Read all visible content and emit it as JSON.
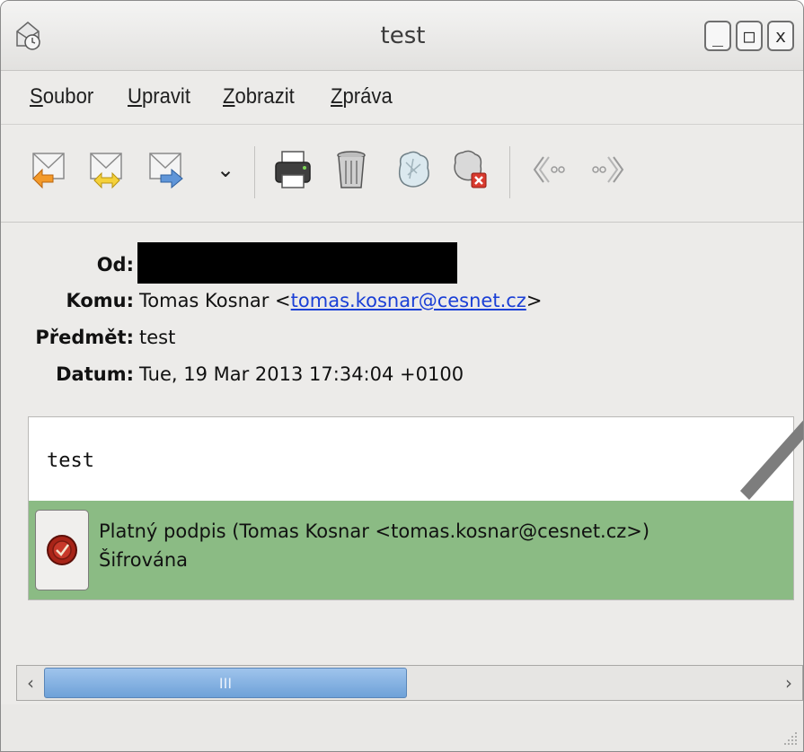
{
  "window": {
    "title": "test",
    "controls": {
      "minimize": "_",
      "maximize": "□",
      "close": "x"
    }
  },
  "menu": {
    "items": [
      {
        "mnemonic": "S",
        "rest": "oubor"
      },
      {
        "mnemonic": "U",
        "rest": "pravit"
      },
      {
        "mnemonic": "Z",
        "rest": "obrazit"
      },
      {
        "mnemonic": "Z",
        "rest": "práva"
      }
    ]
  },
  "toolbar": {
    "icons": [
      "reply-icon",
      "reply-all-icon",
      "forward-icon",
      "dropdown-arrow-icon",
      "print-icon",
      "trash-icon",
      "junk-icon",
      "delete-junk-icon",
      "previous-icon",
      "next-icon"
    ],
    "dropdown_glyph": "⌄"
  },
  "headers": {
    "from_label": "Od:",
    "to_label": "Komu:",
    "to_name": "Tomas Kosnar <",
    "to_email": "tomas.kosnar@cesnet.cz",
    "to_close": ">",
    "subject_label": "Předmět:",
    "subject": "test",
    "date_label": "Datum:",
    "date": "Tue, 19 Mar 2013 17:34:04 +0100"
  },
  "body": {
    "text": "test"
  },
  "signature": {
    "status": "Platný podpis (Tomas Kosnar <tomas.kosnar@cesnet.cz>)",
    "encryption": "Šifrována",
    "bar_color": "#8bbb84"
  },
  "scrollbar": {
    "left_arrow": "‹",
    "right_arrow": "›",
    "thumb_grip": "III"
  }
}
